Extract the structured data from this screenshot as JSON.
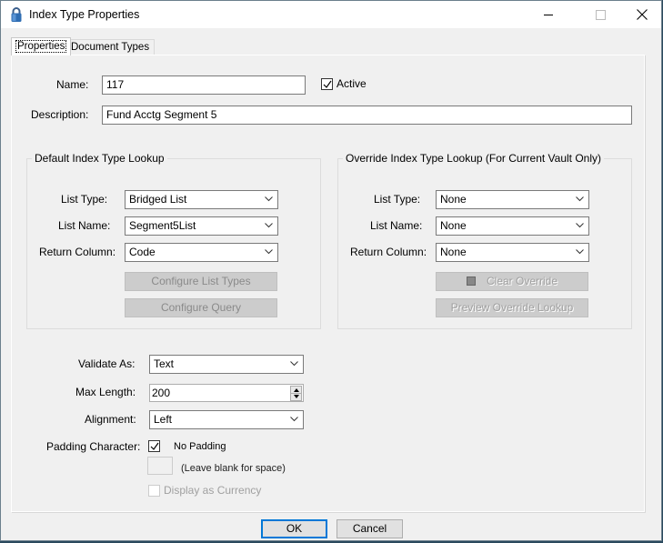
{
  "window": {
    "title": "Index Type Properties",
    "controls": [
      "minimize",
      "maximize",
      "close"
    ]
  },
  "tabs": [
    {
      "label": "Properties",
      "active": true
    },
    {
      "label": "Document Types",
      "active": false
    }
  ],
  "form": {
    "name_label": "Name:",
    "name_value": "117",
    "active_label": "Active",
    "active_checked": true,
    "description_label": "Description:",
    "description_value": "Fund Acctg Segment 5"
  },
  "default_lookup": {
    "title": "Default Index Type Lookup",
    "list_type_label": "List Type:",
    "list_type_value": "Bridged List",
    "list_name_label": "List Name:",
    "list_name_value": "Segment5List",
    "return_column_label": "Return Column:",
    "return_column_value": "Code",
    "configure_list_types_label": "Configure List Types",
    "configure_query_label": "Configure Query"
  },
  "override_lookup": {
    "title": "Override Index Type Lookup (For Current Vault Only)",
    "list_type_label": "List Type:",
    "list_type_value": "None",
    "list_name_label": "List Name:",
    "list_name_value": "None",
    "return_column_label": "Return Column:",
    "return_column_value": "None",
    "clear_override_label": "Clear Override",
    "preview_override_label": "Preview Override Lookup"
  },
  "validation": {
    "validate_as_label": "Validate As:",
    "validate_as_value": "Text",
    "max_length_label": "Max Length:",
    "max_length_value": "200",
    "alignment_label": "Alignment:",
    "alignment_value": "Left",
    "padding_label": "Padding Character:",
    "no_padding_label": "No Padding",
    "no_padding_checked": true,
    "padding_char_value": "",
    "padding_hint": "(Leave blank for space)",
    "currency_label": "Display as Currency",
    "currency_checked": false
  },
  "footer": {
    "ok_label": "OK",
    "cancel_label": "Cancel"
  },
  "icons": {
    "app": "padlock-icon",
    "dropdown": "chevron-down-icon",
    "close": "close-icon"
  },
  "colors": {
    "accent": "#0078d7",
    "window_bg": "#f0f0f0",
    "disabled_button_bg": "#cccccc"
  }
}
